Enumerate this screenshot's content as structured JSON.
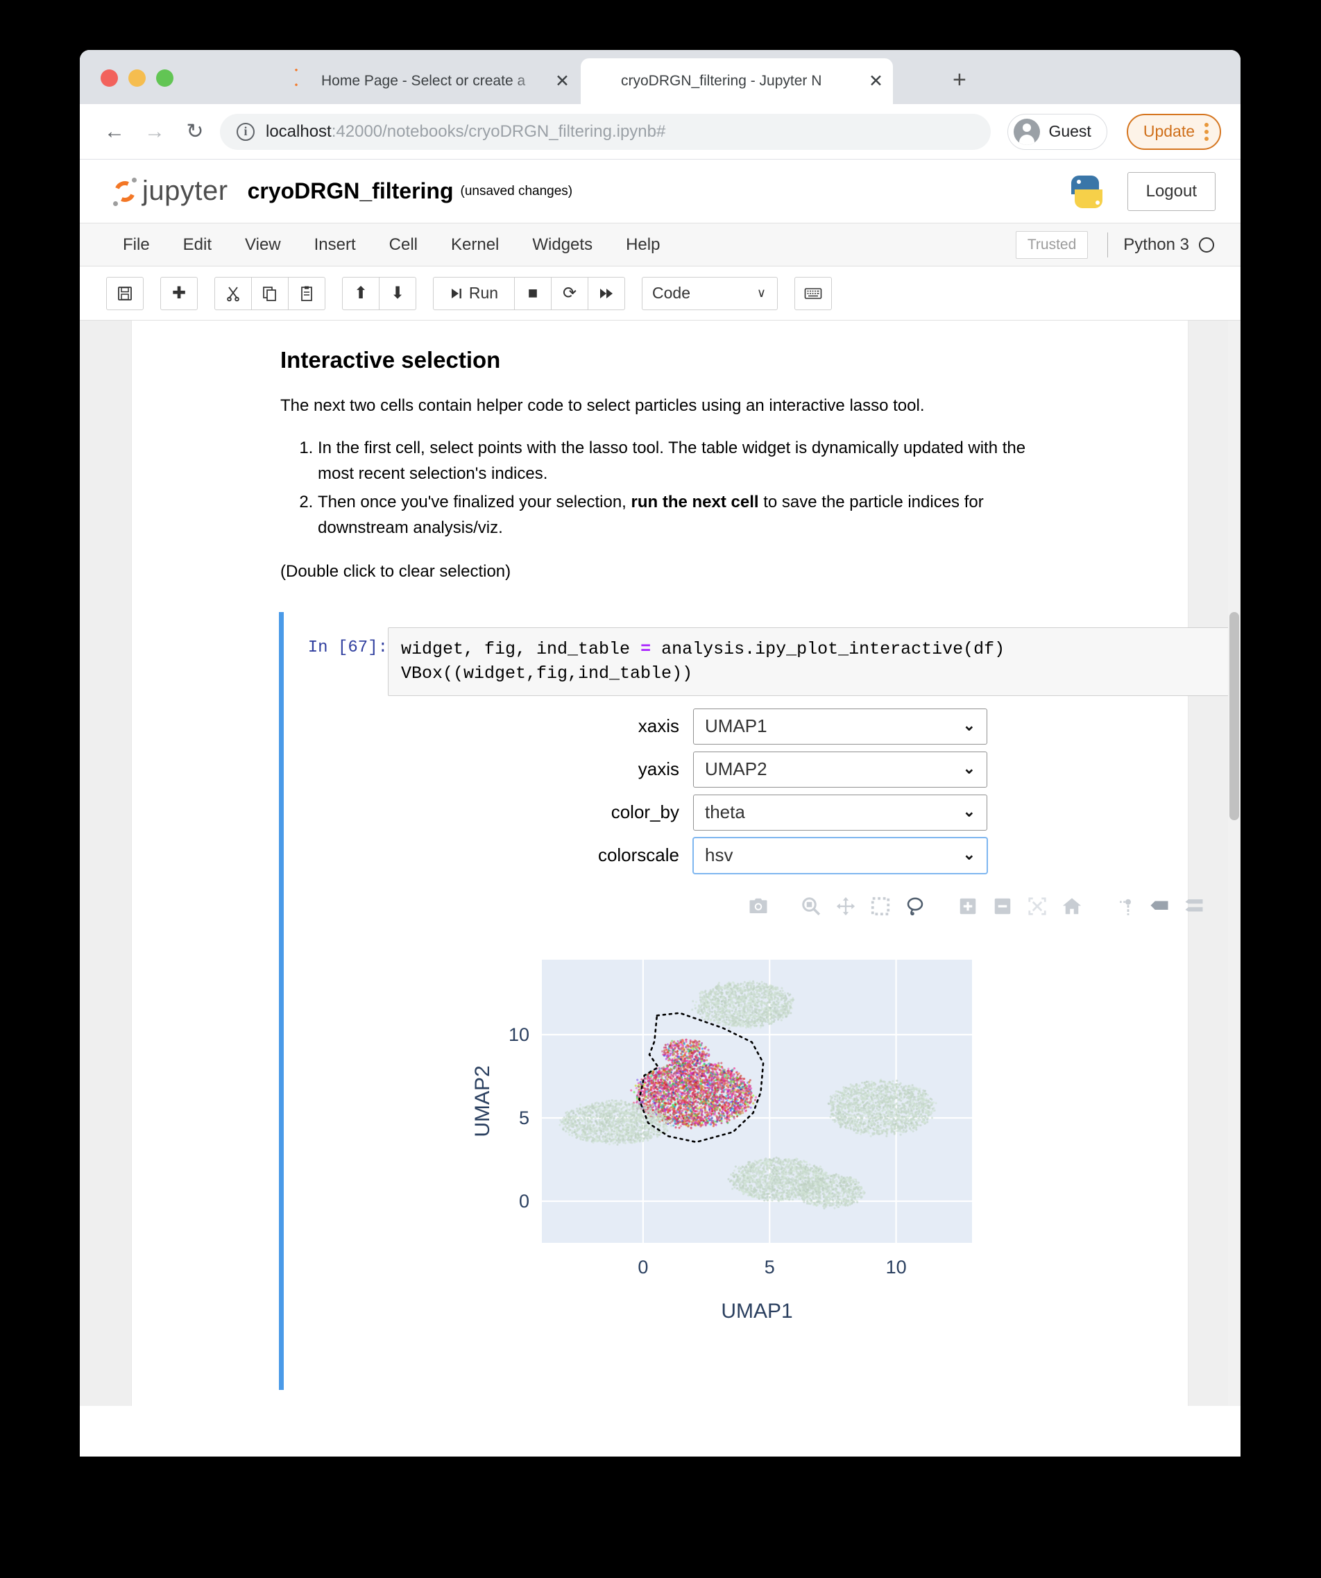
{
  "browser": {
    "tabs": [
      {
        "title": "Home Page - Select or create a",
        "favicon": "jupyter-logo-icon",
        "close": "✕",
        "active": false
      },
      {
        "title": "cryoDRGN_filtering - Jupyter N",
        "favicon": "notebook-icon",
        "close": "✕",
        "active": true
      }
    ],
    "new_tab": "+",
    "nav": {
      "back": "←",
      "forward": "→",
      "reload": "↻"
    },
    "url": {
      "host": "localhost",
      "rest": ":42000/notebooks/cryoDRGN_filtering.ipynb#",
      "info_icon": "ⓘ"
    },
    "profile": {
      "name": "Guest"
    },
    "update": {
      "label": "Update",
      "accent": "#cf6f1a"
    }
  },
  "jupyter": {
    "logo_text": "jupyter",
    "notebook_name": "cryoDRGN_filtering",
    "save_status": "(unsaved changes)",
    "logout_label": "Logout",
    "menu": [
      "File",
      "Edit",
      "View",
      "Insert",
      "Cell",
      "Kernel",
      "Widgets",
      "Help"
    ],
    "trusted_label": "Trusted",
    "kernel_name": "Python 3",
    "toolbar": {
      "save": "💾",
      "insert": "✚",
      "cut": "✂",
      "copy": "❐",
      "paste": "📋",
      "move_up": "⬆",
      "move_down": "⬇",
      "run": "Run",
      "run_icon": "⏭",
      "stop": "■",
      "restart": "⟳",
      "restart_run_all": "⏭⏭",
      "cell_type": "Code",
      "chevron": "∨",
      "keyboard": "⌨"
    }
  },
  "markdown": {
    "title": "Interactive selection",
    "paragraph": "The next two cells contain helper code to select particles using an interactive lasso tool.",
    "list": [
      "In the first cell, select points with the lasso tool. The table widget is dynamically updated with the most recent selection's indices.",
      "Then once you've finalized your selection, run the next cell to save the particle indices for downstream analysis/viz."
    ],
    "list_2_bold": "run the next cell",
    "note": "(Double click to clear selection)"
  },
  "code_cell": {
    "prompt": "In [67]:",
    "line_1_a": "widget, fig, ind_table ",
    "line_1_op": "=",
    "line_1_b": " analysis.ipy_plot_interactive(df)",
    "line_2": "VBox((widget,fig,ind_table))"
  },
  "widgets": [
    {
      "label": "xaxis",
      "value": "UMAP1",
      "focused": false
    },
    {
      "label": "yaxis",
      "value": "UMAP2",
      "focused": false
    },
    {
      "label": "color_by",
      "value": "theta",
      "focused": false
    },
    {
      "label": "colorscale",
      "value": "hsv",
      "focused": true
    }
  ],
  "modebar": [
    "camera-icon",
    "zoom-icon",
    "pan-icon",
    "box-select-icon",
    "lasso-select-icon",
    "zoom-in-icon",
    "zoom-out-icon",
    "autoscale-icon",
    "home-reset-icon",
    "toggle-spikelines-icon",
    "hover-compare-icon",
    "hover-closest-icon",
    "plotly-logo-icon"
  ],
  "chart_data": {
    "type": "scatter",
    "title": "",
    "xlabel": "UMAP1",
    "ylabel": "UMAP2",
    "xlim": [
      -4.0,
      13.0
    ],
    "ylim": [
      -2.5,
      14.5
    ],
    "xticks": [
      0,
      5,
      10
    ],
    "yticks": [
      0,
      5,
      10
    ],
    "grid": true,
    "plot_bgcolor": "#e5ecf6",
    "gridcolor": "#ffffff",
    "tick_color": "#2a3f5f",
    "colorscale": "hsv",
    "color_by": "theta",
    "selection_outline_color": "#000000",
    "selection_outline_style": "dotted",
    "clusters": [
      {
        "name": "selected-cluster",
        "cx": 2.0,
        "cy": 6.4,
        "rx": 2.3,
        "ry": 1.9,
        "n": 5200,
        "selected": true
      },
      {
        "name": "selected-spur",
        "cx": 1.7,
        "cy": 8.9,
        "rx": 0.9,
        "ry": 0.8,
        "n": 700,
        "selected": true
      },
      {
        "name": "top-cluster",
        "cx": 4.0,
        "cy": 11.8,
        "rx": 1.9,
        "ry": 1.35,
        "n": 2600,
        "selected": false
      },
      {
        "name": "left-cluster",
        "cx": -1.1,
        "cy": 4.7,
        "rx": 2.1,
        "ry": 1.25,
        "n": 2600,
        "selected": false
      },
      {
        "name": "right-cluster",
        "cx": 9.4,
        "cy": 5.6,
        "rx": 2.1,
        "ry": 1.6,
        "n": 3000,
        "selected": false
      },
      {
        "name": "bottom-cluster",
        "cx": 5.4,
        "cy": 1.3,
        "rx": 1.9,
        "ry": 1.25,
        "n": 2500,
        "selected": false
      },
      {
        "name": "bottom-right-cluster",
        "cx": 7.4,
        "cy": 0.6,
        "rx": 1.3,
        "ry": 1.0,
        "n": 1200,
        "selected": false
      }
    ],
    "lasso_polygon": [
      [
        0.55,
        11.15
      ],
      [
        1.45,
        11.3
      ],
      [
        3.15,
        10.4
      ],
      [
        4.3,
        9.55
      ],
      [
        4.75,
        8.3
      ],
      [
        4.65,
        6.55
      ],
      [
        4.35,
        5.3
      ],
      [
        3.55,
        4.15
      ],
      [
        2.1,
        3.55
      ],
      [
        1.0,
        3.9
      ],
      [
        0.2,
        4.7
      ],
      [
        -0.15,
        6.1
      ],
      [
        0.05,
        7.55
      ],
      [
        0.6,
        8.05
      ],
      [
        0.25,
        8.8
      ],
      [
        0.45,
        9.6
      ],
      [
        0.55,
        11.15
      ]
    ]
  }
}
